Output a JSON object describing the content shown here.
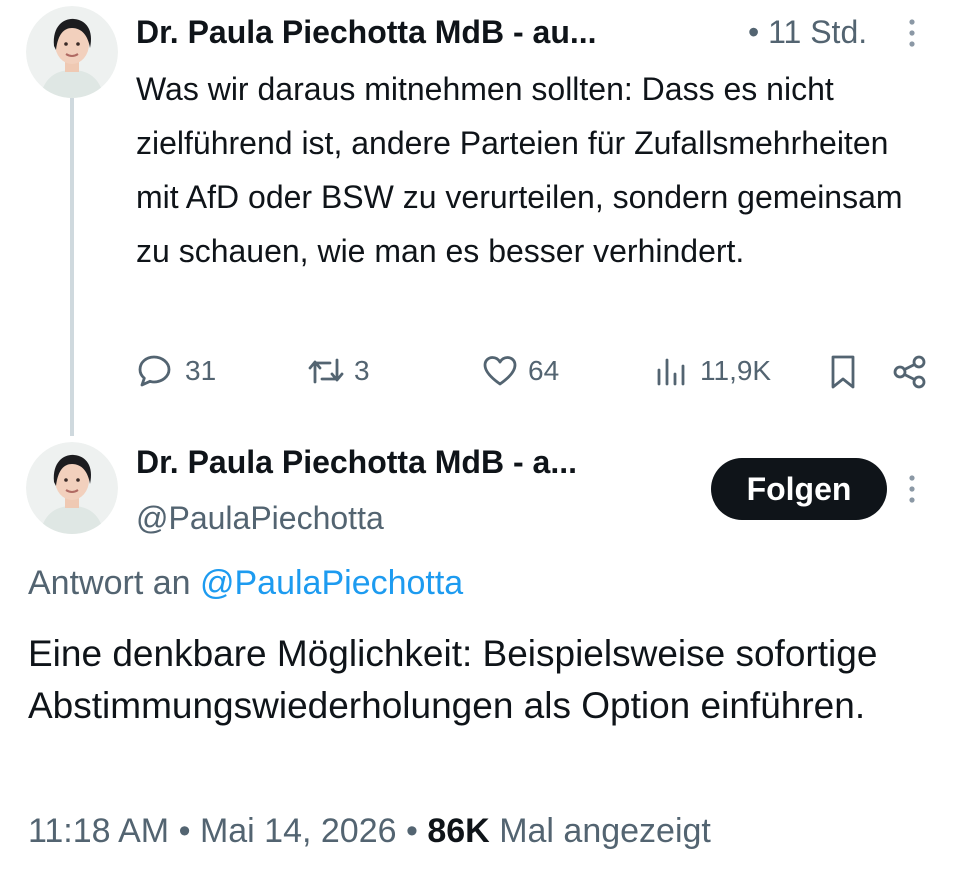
{
  "parent_tweet": {
    "author_name": "Dr. Paula Piechotta MdB - au...",
    "separator": "•",
    "time": "11 Std.",
    "text": "Was wir daraus mitnehmen sollten: Dass es nicht zielführend ist, andere Parteien für Zufallsmehrheiten mit AfD oder BSW zu verurteilen, sondern gemeinsam zu schauen, wie man es besser verhindert.",
    "actions": {
      "replies": "31",
      "reposts": "3",
      "likes": "64",
      "views": "11,9K"
    }
  },
  "main_tweet": {
    "author_name": "Dr. Paula Piechotta MdB - a...",
    "handle": "@PaulaPiechotta",
    "follow_label": "Folgen",
    "reply_prefix": "Antwort an",
    "reply_to": "@PaulaPiechotta",
    "text": "Eine denkbare Möglichkeit: Beispielsweise sofortige Abstimmungswiederholungen als Option einführen.",
    "footer": {
      "time": "11:18 AM",
      "sep1": "•",
      "date": "Mai 14, 2026",
      "sep2": "•",
      "views_count": "86K",
      "views_label": "Mal angezeigt"
    }
  },
  "icons": [
    "reply-icon",
    "repost-icon",
    "like-icon",
    "views-icon",
    "bookmark-icon",
    "share-icon",
    "more-icon"
  ],
  "colors": {
    "accent": "#1d9bf0",
    "text": "#0f1419",
    "muted": "#536471",
    "line": "#cfd9de"
  }
}
